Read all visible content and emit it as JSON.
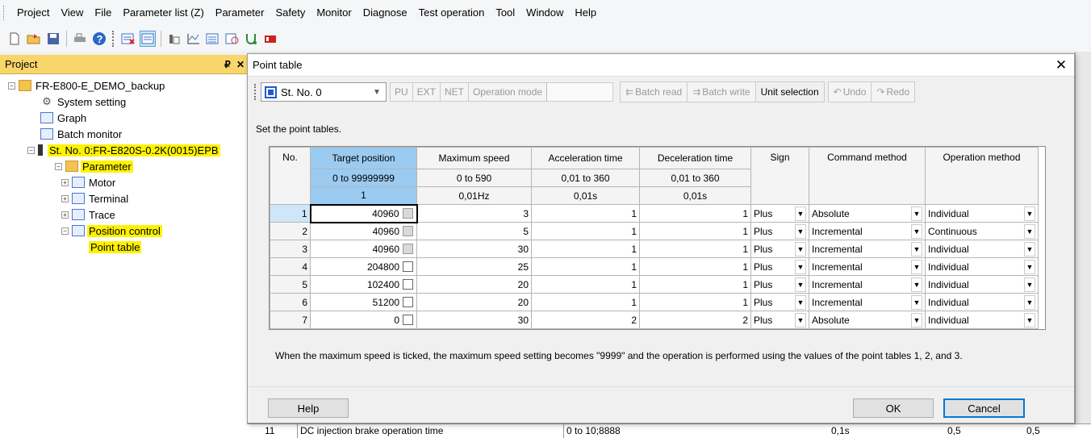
{
  "menu": [
    "Project",
    "View",
    "File",
    "Parameter list (Z)",
    "Parameter",
    "Safety",
    "Monitor",
    "Diagnose",
    "Test operation",
    "Tool",
    "Window",
    "Help"
  ],
  "toolbar_icons": [
    "new-icon",
    "open-icon",
    "save-icon",
    "print-icon",
    "help-icon",
    "offline-icon",
    "online-icon",
    "list-icon",
    "graph-icon",
    "batch-icon",
    "compare-icon",
    "diag-icon",
    "test-icon"
  ],
  "project": {
    "title": "Project",
    "pin": "₽",
    "close": "✕",
    "tree": [
      {
        "label": "FR-E800-E_DEMO_backup",
        "level": 0,
        "icon": "folder-icon",
        "expand": "−",
        "highlight": false
      },
      {
        "label": "System setting",
        "level": 1,
        "icon": "gear-icon",
        "expand": "",
        "highlight": false
      },
      {
        "label": "Graph",
        "level": 1,
        "icon": "graph-icon",
        "expand": "",
        "highlight": false
      },
      {
        "label": "Batch monitor",
        "level": 1,
        "icon": "monitor-icon",
        "expand": "",
        "highlight": false
      },
      {
        "label": "St. No. 0:FR-E820S-0.2K(0015)EPB",
        "level": 1,
        "icon": "device-icon",
        "expand": "−",
        "highlight": true
      },
      {
        "label": "Parameter",
        "level": 2,
        "icon": "parameter-icon",
        "expand": "−",
        "highlight": true
      },
      {
        "label": "Motor",
        "level": 3,
        "icon": "grid-icon",
        "expand": "+",
        "highlight": false
      },
      {
        "label": "Terminal",
        "level": 3,
        "icon": "grid-icon",
        "expand": "+",
        "highlight": false
      },
      {
        "label": "Trace",
        "level": 3,
        "icon": "grid-icon",
        "expand": "+",
        "highlight": false
      },
      {
        "label": "Position control",
        "level": 3,
        "icon": "grid-icon",
        "expand": "−",
        "highlight": true
      },
      {
        "label": "Point table",
        "level": 4,
        "icon": "",
        "expand": "",
        "highlight": true
      }
    ]
  },
  "dialog": {
    "title": "Point table",
    "close": "✕",
    "station": "St. No. 0",
    "modes": [
      "PU",
      "EXT",
      "NET",
      "Operation mode"
    ],
    "batch_read": "Batch read",
    "batch_write": "Batch write",
    "unit_selection": "Unit selection",
    "undo": "Undo",
    "redo": "Redo",
    "hint": "Set the point tables.",
    "columns": [
      "No.",
      "Target position",
      "Maximum speed",
      "Acceleration time",
      "Deceleration time",
      "Sign",
      "Command method",
      "Operation method"
    ],
    "ranges": [
      "0 to 99999999",
      "0 to 590",
      "0,01 to 360",
      "0,01 to 360"
    ],
    "units": [
      "1",
      "0,01Hz",
      "0,01s",
      "0,01s"
    ],
    "rows": [
      {
        "no": "1",
        "target": "40960",
        "max_checked": false,
        "max_disabled": true,
        "speed": "3",
        "accel": "1",
        "decel": "1",
        "sign": "Plus",
        "command": "Absolute",
        "operation": "Individual"
      },
      {
        "no": "2",
        "target": "40960",
        "max_checked": false,
        "max_disabled": true,
        "speed": "5",
        "accel": "1",
        "decel": "1",
        "sign": "Plus",
        "command": "Incremental",
        "operation": "Continuous"
      },
      {
        "no": "3",
        "target": "40960",
        "max_checked": false,
        "max_disabled": true,
        "speed": "30",
        "accel": "1",
        "decel": "1",
        "sign": "Plus",
        "command": "Incremental",
        "operation": "Individual"
      },
      {
        "no": "4",
        "target": "204800",
        "max_checked": false,
        "max_disabled": false,
        "speed": "25",
        "accel": "1",
        "decel": "1",
        "sign": "Plus",
        "command": "Incremental",
        "operation": "Individual"
      },
      {
        "no": "5",
        "target": "102400",
        "max_checked": false,
        "max_disabled": false,
        "speed": "20",
        "accel": "1",
        "decel": "1",
        "sign": "Plus",
        "command": "Incremental",
        "operation": "Individual"
      },
      {
        "no": "6",
        "target": "51200",
        "max_checked": false,
        "max_disabled": false,
        "speed": "20",
        "accel": "1",
        "decel": "1",
        "sign": "Plus",
        "command": "Incremental",
        "operation": "Individual"
      },
      {
        "no": "7",
        "target": "0",
        "max_checked": false,
        "max_disabled": false,
        "speed": "30",
        "accel": "2",
        "decel": "2",
        "sign": "Plus",
        "command": "Absolute",
        "operation": "Individual"
      }
    ],
    "note": "When the maximum speed is ticked, the maximum speed setting becomes \"9999\" and the operation is performed using the values of the point tables 1, 2, and 3.",
    "help": "Help",
    "ok": "OK",
    "cancel": "Cancel"
  },
  "background_row": {
    "no": "11",
    "name": "DC injection brake operation time",
    "range": "0 to 10;8888",
    "unit": "0,1s",
    "v1": "0,5",
    "v2": "0,5"
  }
}
